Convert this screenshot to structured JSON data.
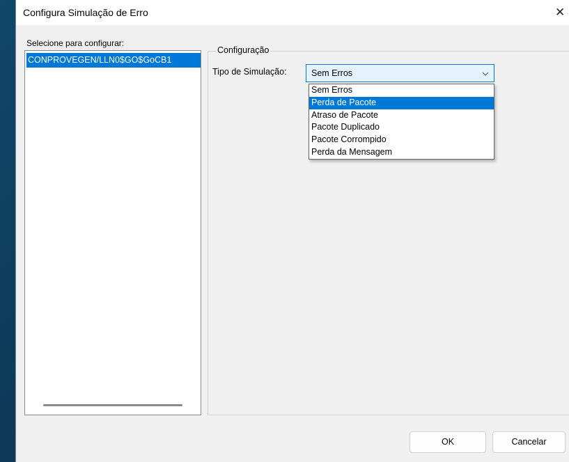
{
  "window": {
    "title": "Configura Simulação de Erro",
    "close_glyph": "✕"
  },
  "left_panel": {
    "label": "Selecione para configurar:",
    "items": [
      {
        "label": "CONPROVEGEN/LLN0$GO$GoCB1",
        "selected": true
      }
    ]
  },
  "config": {
    "group_title": "Configuração",
    "tipo_label": "Tipo de Simulação:",
    "combo_value": "Sem Erros",
    "options": [
      {
        "label": "Sem Erros",
        "selected": false
      },
      {
        "label": "Perda de Pacote",
        "selected": true
      },
      {
        "label": "Atraso de Pacote",
        "selected": false
      },
      {
        "label": "Pacote Duplicado",
        "selected": false
      },
      {
        "label": "Pacote Corrompido",
        "selected": false
      },
      {
        "label": "Perda da Mensagem",
        "selected": false
      }
    ]
  },
  "buttons": {
    "ok": "OK",
    "cancel": "Cancelar"
  },
  "colors": {
    "selection": "#0078d7",
    "dialog_bg": "#f0f0f0",
    "desktop_bg": "#0d3a59"
  },
  "icons": {
    "combo_arrow": "chevron-down-icon",
    "close": "close-icon"
  }
}
